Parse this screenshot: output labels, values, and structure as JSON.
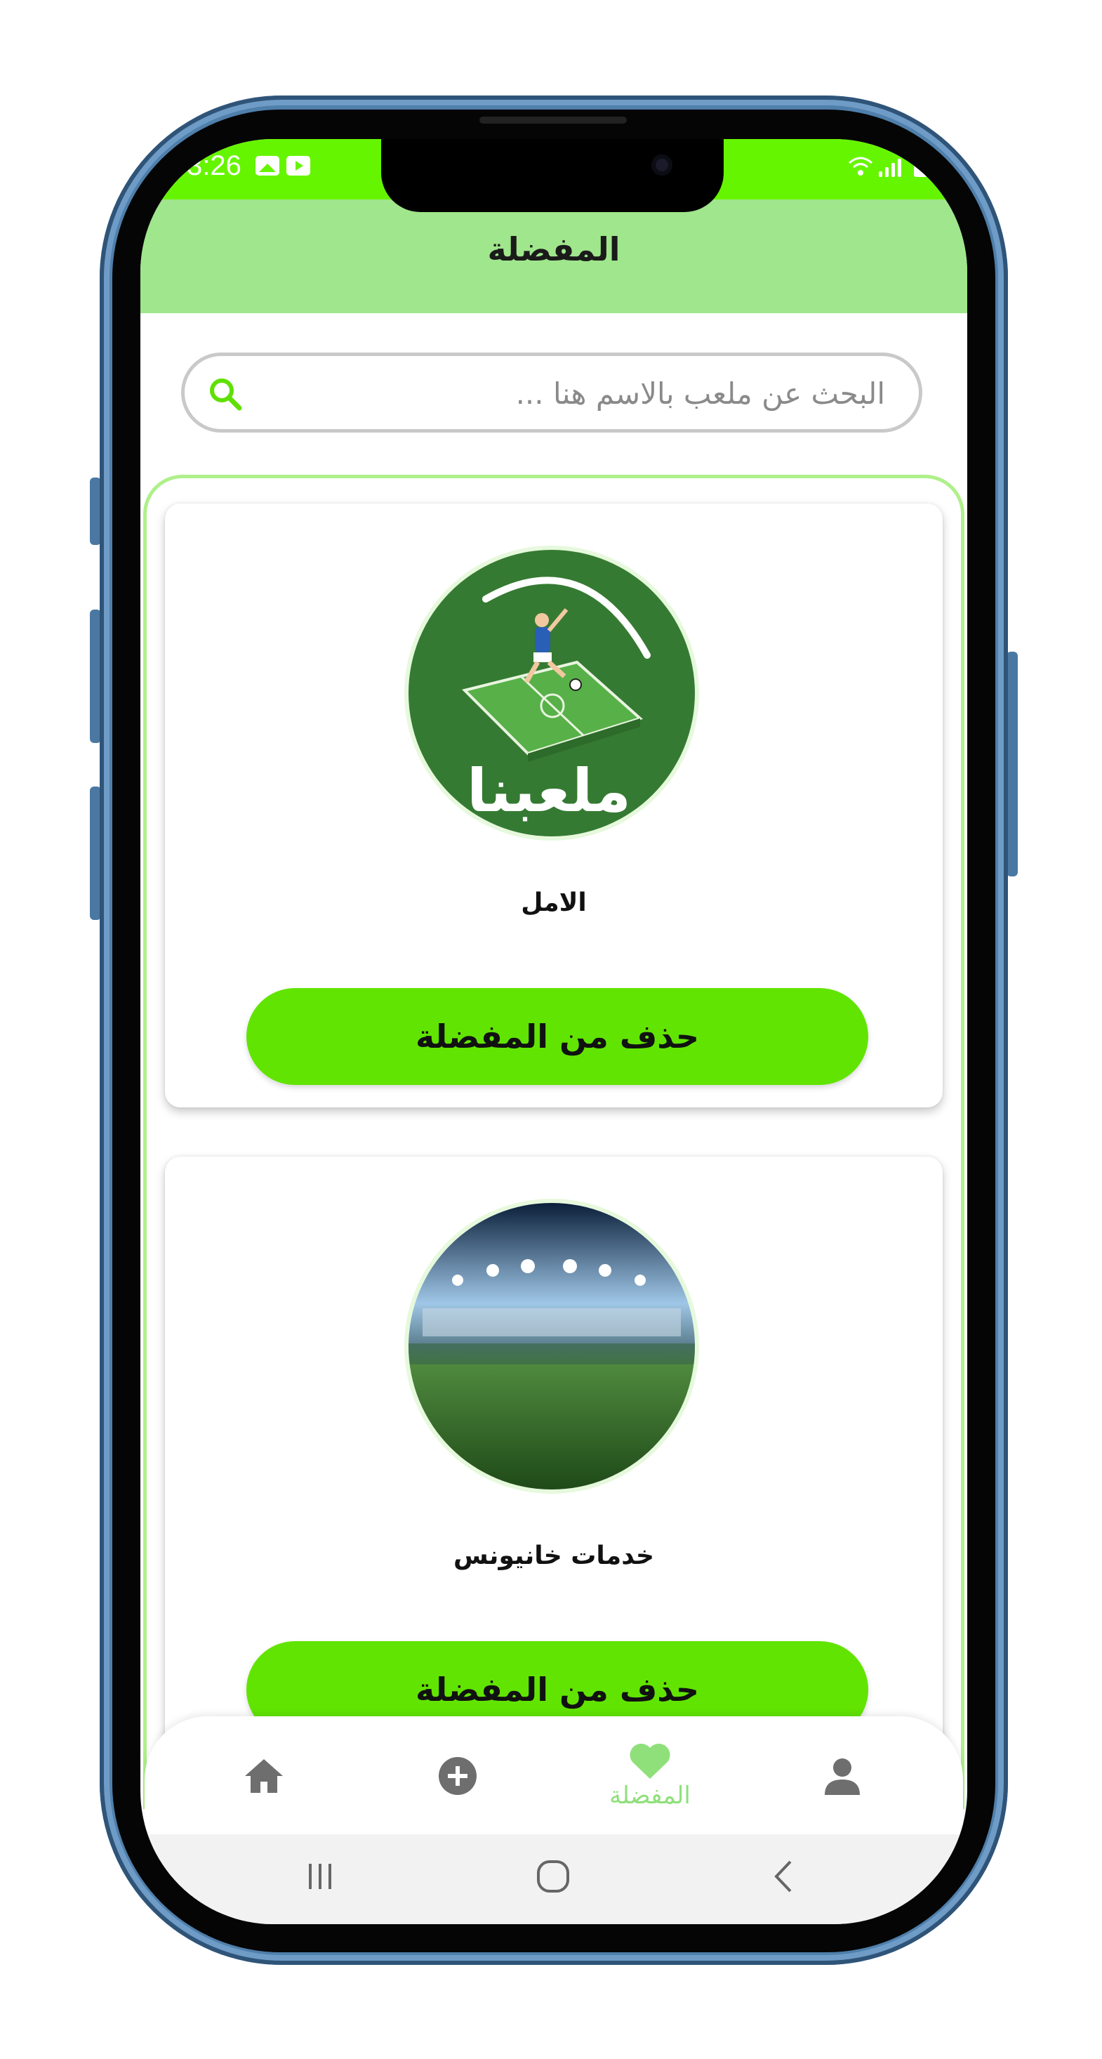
{
  "status_bar": {
    "time": "3:26"
  },
  "header": {
    "title": "المفضلة"
  },
  "search": {
    "placeholder": "البحث عن ملعب بالاسم هنا ..."
  },
  "cards": [
    {
      "name": "الامل",
      "button_label": "حذف من المفضلة",
      "logo_text": "ملعبنا"
    },
    {
      "name": "خدمات خانيونس",
      "button_label": "حذف من المفضلة"
    }
  ],
  "bottom_nav": {
    "items": [
      {
        "icon": "home-icon",
        "label": ""
      },
      {
        "icon": "add-circle-icon",
        "label": ""
      },
      {
        "icon": "heart-icon",
        "label": "المفضلة",
        "active": true
      },
      {
        "icon": "person-icon",
        "label": ""
      }
    ]
  },
  "colors": {
    "status_bar": "#66f500",
    "header": "#a0e68c",
    "button": "#61e402",
    "nav_active": "#8fe07a",
    "nav_inactive": "#6e6e6e"
  }
}
